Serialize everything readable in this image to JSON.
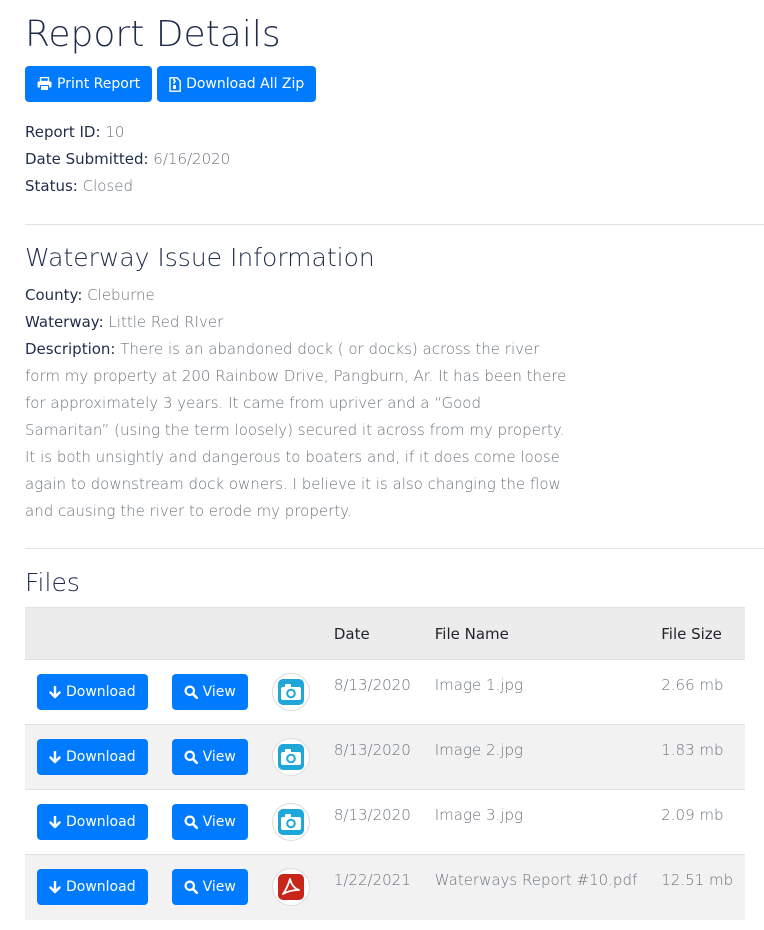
{
  "header": {
    "title": "Report Details",
    "print_label": "Print Report",
    "zip_label": "Download All Zip"
  },
  "report": {
    "id_label": "Report ID:",
    "id_value": "10",
    "date_label": "Date Submitted:",
    "date_value": "6/16/2020",
    "status_label": "Status:",
    "status_value": "Closed"
  },
  "waterway": {
    "section_title": "Waterway Issue Information",
    "county_label": "County:",
    "county_value": "Cleburne",
    "waterway_label": "Waterway:",
    "waterway_value": "Little Red RIver",
    "description_label": "Description:",
    "description_value": "There is an abandoned dock ( or docks) across the river form my property at 200 Rainbow Drive, Pangburn, Ar. It has been there for approximately 3 years. It came from upriver and a “Good Samaritan” (using the term loosely) secured it across from my property. It is both unsightly and dangerous to boaters and, if it does come loose again to downstream dock owners. I believe it is also changing the flow and causing the river to erode my property."
  },
  "files": {
    "section_title": "Files",
    "columns": [
      "",
      "",
      "",
      "Date",
      "File Name",
      "File Size"
    ],
    "download_label": "Download",
    "view_label": "View",
    "rows": [
      {
        "type": "camera-icon",
        "date": "8/13/2020",
        "name": "Image 1.jpg",
        "size": "2.66 mb"
      },
      {
        "type": "camera-icon",
        "date": "8/13/2020",
        "name": "Image 2.jpg",
        "size": "1.83 mb"
      },
      {
        "type": "camera-icon",
        "date": "8/13/2020",
        "name": "Image 3.jpg",
        "size": "2.09 mb"
      },
      {
        "type": "pdf-icon",
        "date": "1/22/2021",
        "name": "Waterways Report #10.pdf",
        "size": "12.51 mb"
      }
    ]
  },
  "colors": {
    "primary": "#007bff",
    "heading": "#1f2d4a",
    "muted": "#6c757d",
    "camera": "#1ea7d8",
    "pdf": "#c8261b"
  }
}
